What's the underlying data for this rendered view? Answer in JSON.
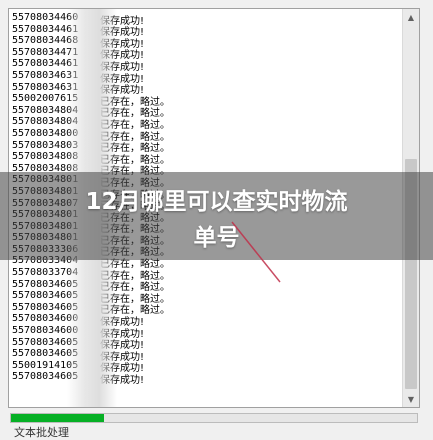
{
  "banner": {
    "title_line1": "12月哪里可以查实时物流",
    "title_line2": "单号"
  },
  "log": {
    "lines": [
      {
        "id": "55708034460",
        "msg": "保存成功!"
      },
      {
        "id": "55708034461",
        "msg": "保存成功!"
      },
      {
        "id": "55708034468",
        "msg": "保存成功!"
      },
      {
        "id": "55708034471",
        "msg": "保存成功!"
      },
      {
        "id": "55708034461",
        "msg": "保存成功!"
      },
      {
        "id": "55708034631",
        "msg": "保存成功!"
      },
      {
        "id": "55708034631",
        "msg": "保存成功!"
      },
      {
        "id": "55002007615",
        "msg": "已存在，略过。"
      },
      {
        "id": "55708034804",
        "msg": "已存在，略过。"
      },
      {
        "id": "55708034804",
        "msg": "已存在，略过。"
      },
      {
        "id": "55708034800",
        "msg": "已存在，略过。"
      },
      {
        "id": "55708034803",
        "msg": "已存在，略过。"
      },
      {
        "id": "55708034808",
        "msg": "已存在，略过。"
      },
      {
        "id": "55708034808",
        "msg": "已存在，略过。"
      },
      {
        "id": "55708034801",
        "msg": "已存在，略过。"
      },
      {
        "id": "55708034801",
        "msg": "已存在，略过。"
      },
      {
        "id": "55708034807",
        "msg": "已存在，略过。"
      },
      {
        "id": "55708034801",
        "msg": "已存在，略过。"
      },
      {
        "id": "55708034801",
        "msg": "已存在，略过。"
      },
      {
        "id": "55708034801",
        "msg": "已存在，略过。"
      },
      {
        "id": "55708033306",
        "msg": "已存在，略过。"
      },
      {
        "id": "55708033404",
        "msg": "已存在，略过。"
      },
      {
        "id": "55708033704",
        "msg": "已存在，略过。"
      },
      {
        "id": "55708034605",
        "msg": "已存在，略过。"
      },
      {
        "id": "55708034605",
        "msg": "已存在，略过。"
      },
      {
        "id": "55708034605",
        "msg": "已存在，略过。"
      },
      {
        "id": "55708034600",
        "msg": "保存成功!"
      },
      {
        "id": "55708034600",
        "msg": "保存成功!"
      },
      {
        "id": "55708034605",
        "msg": "保存成功!"
      },
      {
        "id": "55708034605",
        "msg": "保存成功!"
      },
      {
        "id": "55001914105",
        "msg": "保存成功!"
      },
      {
        "id": "55708034605",
        "msg": "保存成功!"
      }
    ]
  },
  "progress": {
    "percent": 23
  },
  "status": {
    "text": "文本批处理"
  },
  "colors": {
    "progress_fill": "#06b025",
    "accent_line": "#c0304a"
  },
  "icons": {
    "scroll_up": "▲",
    "scroll_down": "▼"
  }
}
